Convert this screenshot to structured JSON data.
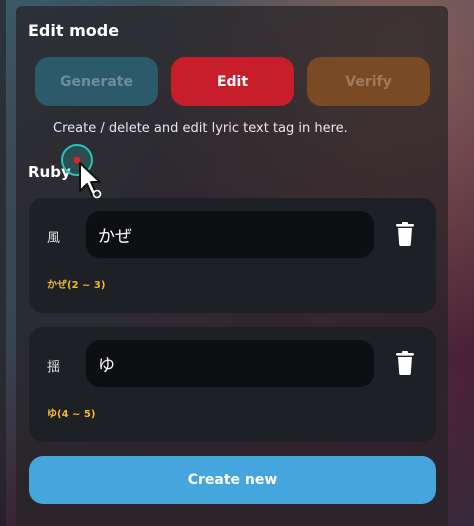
{
  "panel": {
    "title": "Edit mode"
  },
  "modes": {
    "generate_label": "Generate",
    "edit_label": "Edit",
    "verify_label": "Verify",
    "selected": "Edit"
  },
  "description": "Create / delete and edit lyric text tag in here.",
  "ruby": {
    "section_label": "Ruby",
    "items": [
      {
        "kanji": "風",
        "value": "かぜ",
        "range": "かぜ(2 ~ 3)"
      },
      {
        "kanji": "揺",
        "value": "ゆ",
        "range": "ゆ(4 ~ 5)"
      }
    ]
  },
  "actions": {
    "create_label": "Create new"
  },
  "icons": {
    "delete": "trash-icon",
    "cursor": "mouse-pointer-icon"
  },
  "colors": {
    "generate_button": "#2b5a6b",
    "edit_button": "#c81e2c",
    "verify_button": "#7a4a25",
    "create_button": "#44a6dc",
    "range_text": "#f2b92b",
    "card_background": "#1d2024"
  }
}
